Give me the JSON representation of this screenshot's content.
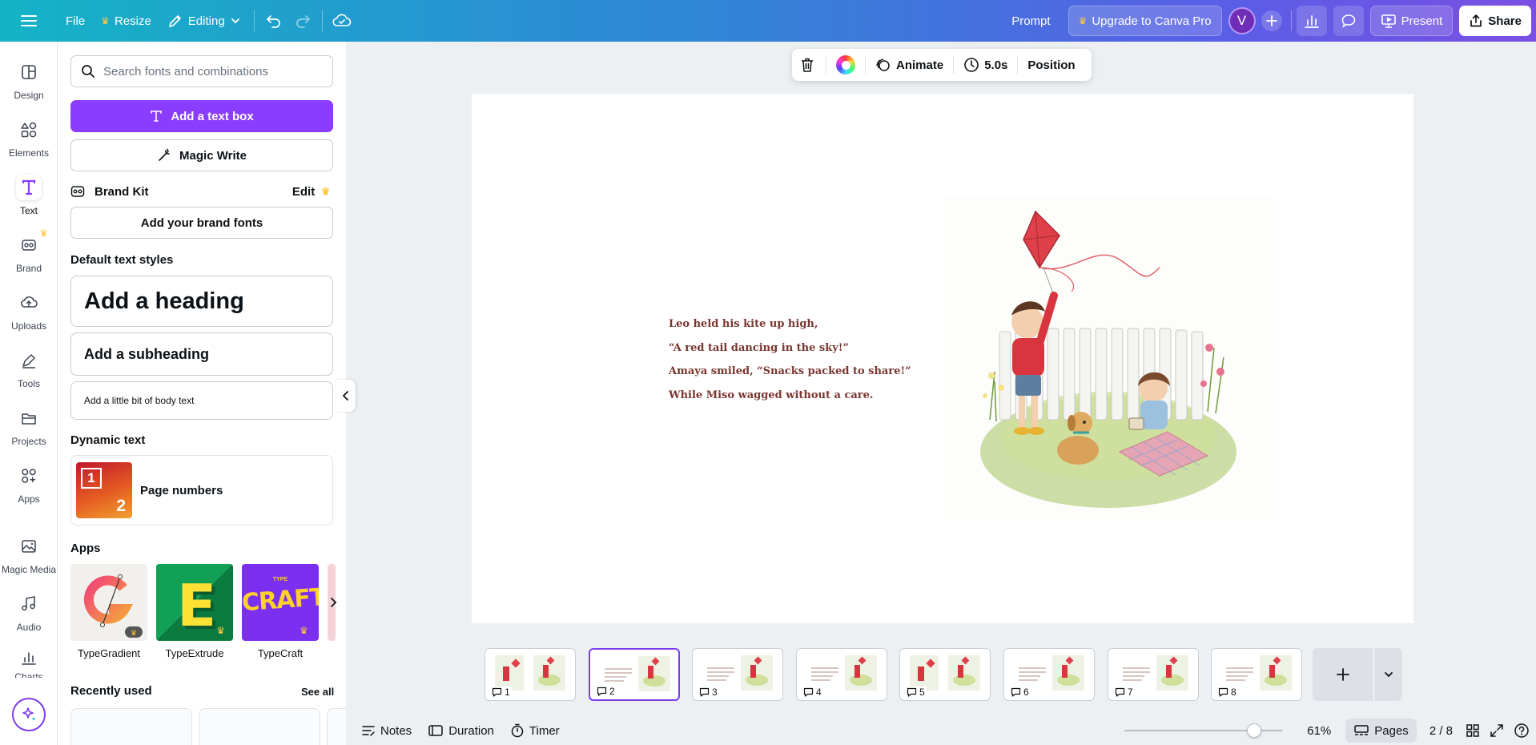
{
  "topbar": {
    "file": "File",
    "resize": "Resize",
    "mode": "Editing",
    "prompt": "Prompt",
    "upgrade": "Upgrade to Canva Pro",
    "avatar_initial": "V",
    "present": "Present",
    "share": "Share"
  },
  "rail": [
    {
      "label": "Design",
      "icon": "design-icon"
    },
    {
      "label": "Elements",
      "icon": "elements-icon"
    },
    {
      "label": "Text",
      "icon": "text-icon",
      "active": true
    },
    {
      "label": "Brand",
      "icon": "brand-icon"
    },
    {
      "label": "Uploads",
      "icon": "uploads-icon"
    },
    {
      "label": "Tools",
      "icon": "tools-icon"
    },
    {
      "label": "Projects",
      "icon": "projects-icon"
    },
    {
      "label": "Apps",
      "icon": "apps-icon"
    },
    {
      "label": "Magic Media",
      "icon": "magic-media-icon"
    },
    {
      "label": "Audio",
      "icon": "audio-icon"
    },
    {
      "label": "Charts",
      "icon": "charts-icon"
    }
  ],
  "panel": {
    "search_placeholder": "Search fonts and combinations",
    "add_text_box": "Add a text box",
    "magic_write": "Magic Write",
    "brand_kit": "Brand Kit",
    "brand_edit": "Edit",
    "add_brand_fonts": "Add your brand fonts",
    "default_styles_title": "Default text styles",
    "heading": "Add a heading",
    "subheading": "Add a subheading",
    "body": "Add a little bit of body text",
    "dynamic_title": "Dynamic text",
    "page_numbers": "Page numbers",
    "page_numbers_thumb": [
      "1",
      "2"
    ],
    "apps_title": "Apps",
    "apps": [
      "TypeGradient",
      "TypeExtrude",
      "TypeCraft"
    ],
    "app_tile_text": {
      "extrude": "E",
      "craft": "CRAFT",
      "craft_small": "TYPE"
    },
    "recently_used": "Recently used",
    "see_all": "See all"
  },
  "context_toolbar": {
    "animate": "Animate",
    "duration": "5.0s",
    "position": "Position"
  },
  "page": {
    "story_lines": [
      "Leo held his kite up high,",
      "“A red tail dancing in the sky!”",
      "Amaya smiled, “Snacks packed to share!”",
      "While Miso wagged without a care."
    ]
  },
  "filmstrip": {
    "pages": [
      "1",
      "2",
      "3",
      "4",
      "5",
      "6",
      "7",
      "8"
    ],
    "active_page": 2
  },
  "bottombar": {
    "notes": "Notes",
    "duration": "Duration",
    "timer": "Timer",
    "zoom": "61%",
    "zoom_fraction": 0.61,
    "pages": "Pages",
    "page_count": "2 / 8"
  },
  "colors": {
    "accent": "#8b3dff",
    "story_text": "#7a3530",
    "kite": "#e0404a"
  }
}
